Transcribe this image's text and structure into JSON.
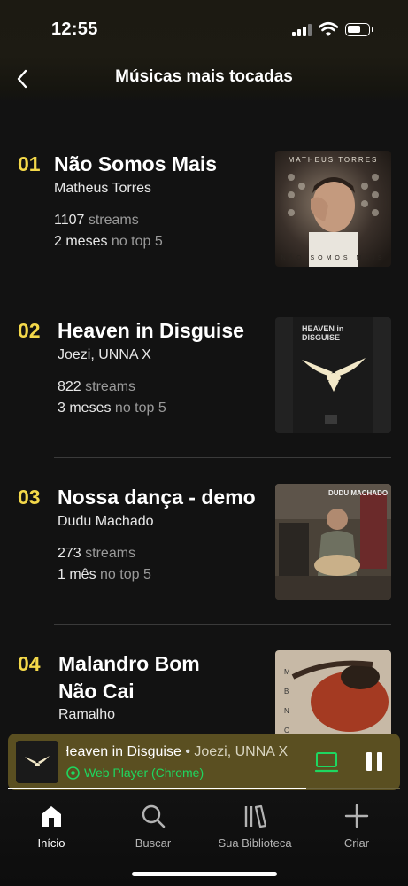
{
  "status_bar": {
    "time": "12:55"
  },
  "header": {
    "title": "Músicas mais tocadas"
  },
  "tracks": [
    {
      "rank": "01",
      "title": "Não Somos Mais",
      "artist": "Matheus Torres",
      "streams": "1107",
      "streams_label": "streams",
      "period": "2 meses",
      "period_label": "no top 5",
      "cover_text": "MATHEUS TORRES",
      "cover_subtext": "NÃO SOMOS MAIS"
    },
    {
      "rank": "02",
      "title": "Heaven in Disguise",
      "artist": "Joezi, UNNA X",
      "streams": "822",
      "streams_label": "streams",
      "period": "3 meses",
      "period_label": "no top 5",
      "cover_text": "HEAVEN in DISGUISE"
    },
    {
      "rank": "03",
      "title": "Nossa dança - demo",
      "artist": "Dudu Machado",
      "streams": "273",
      "streams_label": "streams",
      "period": "1 mês",
      "period_label": "no top 5",
      "cover_text": "DUDU MACHADO"
    },
    {
      "rank": "04",
      "title": "Malandro Bom Não Cai",
      "artist": "Ramalho",
      "streams": "",
      "streams_label": "",
      "period": "",
      "period_label": "",
      "cover_text": "M B N C"
    }
  ],
  "mini_player": {
    "title": "Heaven in Disguise",
    "separator": "•",
    "artist": "Joezi, UNNA X",
    "device": "Web Player (Chrome)",
    "progress": 0.76,
    "accent": "#1ed760",
    "background": "#5a4f21"
  },
  "tabs": [
    {
      "label": "Início",
      "icon": "home-icon",
      "active": true
    },
    {
      "label": "Buscar",
      "icon": "search-icon",
      "active": false
    },
    {
      "label": "Sua Biblioteca",
      "icon": "library-icon",
      "active": false
    },
    {
      "label": "Criar",
      "icon": "plus-icon",
      "active": false
    }
  ],
  "colors": {
    "rank": "#f3d84a",
    "background": "#121212"
  }
}
